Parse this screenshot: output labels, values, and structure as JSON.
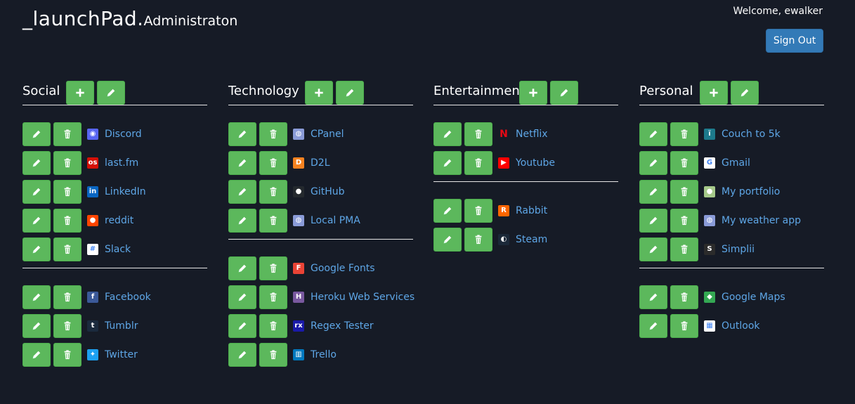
{
  "header": {
    "brand_main": "_launchPad.",
    "brand_sub": "Administraton",
    "welcome": "Welcome, ewalker",
    "signout_label": "Sign Out"
  },
  "colors": {
    "background": "#161b26",
    "button_green": "#5cb85c",
    "signout_blue": "#337ab7",
    "link": "#5ea6e6"
  },
  "columns": [
    {
      "title": "Social",
      "groups": [
        [
          {
            "label": "Discord",
            "icon": "discord-icon",
            "color": "#5865f2",
            "glyph": "◉"
          },
          {
            "label": "last.fm",
            "icon": "lastfm-icon",
            "color": "#d51007",
            "glyph": "os"
          },
          {
            "label": "LinkedIn",
            "icon": "linkedin-icon",
            "color": "#0a66c2",
            "glyph": "in"
          },
          {
            "label": "reddit",
            "icon": "reddit-icon",
            "color": "#ff4500",
            "glyph": "●"
          },
          {
            "label": "Slack",
            "icon": "slack-icon",
            "color": "#ffffff",
            "glyph": "#"
          }
        ],
        [
          {
            "label": "Facebook",
            "icon": "facebook-icon",
            "color": "#3b5998",
            "glyph": "f"
          },
          {
            "label": "Tumblr",
            "icon": "tumblr-icon",
            "color": "#1b2a3d",
            "glyph": "t"
          },
          {
            "label": "Twitter",
            "icon": "twitter-icon",
            "color": "#1da1f2",
            "glyph": "✦"
          }
        ]
      ]
    },
    {
      "title": "Technology",
      "groups": [
        [
          {
            "label": "CPanel",
            "icon": "globe-icon",
            "color": "#8a9bd8",
            "glyph": "◍"
          },
          {
            "label": "D2L",
            "icon": "d2l-icon",
            "color": "#f58220",
            "glyph": "D"
          },
          {
            "label": "GitHub",
            "icon": "github-icon",
            "color": "#24292e",
            "glyph": "●"
          },
          {
            "label": "Local PMA",
            "icon": "globe-icon",
            "color": "#8a9bd8",
            "glyph": "◍"
          }
        ],
        [
          {
            "label": "Google Fonts",
            "icon": "google-fonts-icon",
            "color": "#ea4335",
            "glyph": "F"
          },
          {
            "label": "Heroku Web Services",
            "icon": "heroku-icon",
            "color": "#79589f",
            "glyph": "H"
          },
          {
            "label": "Regex Tester",
            "icon": "regex-tester-icon",
            "color": "#1a1aa8",
            "glyph": "rx"
          },
          {
            "label": "Trello",
            "icon": "trello-icon",
            "color": "#0079bf",
            "glyph": "▥"
          }
        ]
      ]
    },
    {
      "title": "Entertainment",
      "groups": [
        [
          {
            "label": "Netflix",
            "icon": "netflix-icon",
            "color": "#161b26",
            "glyph": "N"
          },
          {
            "label": "Youtube",
            "icon": "youtube-icon",
            "color": "#ff0000",
            "glyph": "▶"
          }
        ],
        [
          {
            "label": "Rabbit",
            "icon": "rabbit-icon",
            "color": "#ff6600",
            "glyph": "R"
          },
          {
            "label": "Steam",
            "icon": "steam-icon",
            "color": "#1b2838",
            "glyph": "◐"
          }
        ]
      ]
    },
    {
      "title": "Personal",
      "groups": [
        [
          {
            "label": "Couch to 5k",
            "icon": "couch-to-5k-icon",
            "color": "#1d7a8c",
            "glyph": "ı̈"
          },
          {
            "label": "Gmail",
            "icon": "google-icon",
            "color": "#ffffff",
            "glyph": "G"
          },
          {
            "label": "My portfolio",
            "icon": "portfolio-icon",
            "color": "#a6c98a",
            "glyph": "●"
          },
          {
            "label": "My weather app",
            "icon": "globe-icon",
            "color": "#8a9bd8",
            "glyph": "◍"
          },
          {
            "label": "Simplii",
            "icon": "simplii-icon",
            "color": "#2b2b2b",
            "glyph": "S"
          }
        ],
        [
          {
            "label": "Google Maps",
            "icon": "google-maps-icon",
            "color": "#34a853",
            "glyph": "◆"
          },
          {
            "label": "Outlook",
            "icon": "microsoft-icon",
            "color": "#ffffff",
            "glyph": "▦"
          }
        ]
      ]
    }
  ]
}
